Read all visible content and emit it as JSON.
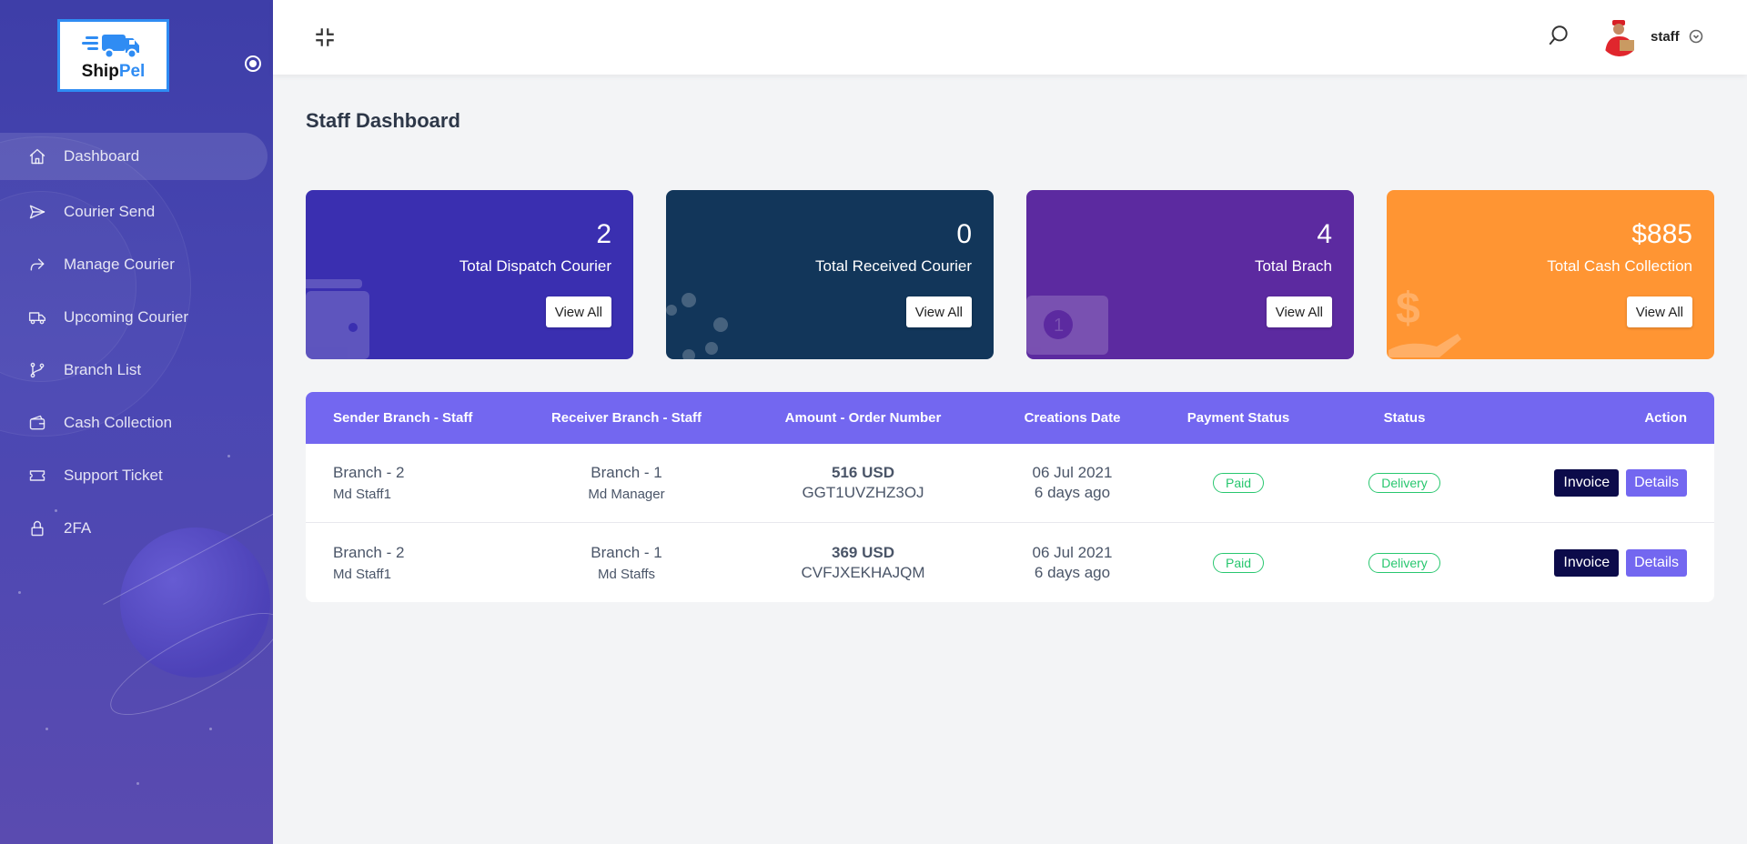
{
  "app": {
    "logo_part1": "Ship",
    "logo_part2": "Pel"
  },
  "sidebar": {
    "items": [
      {
        "label": "Dashboard",
        "icon": "home-icon",
        "active": true
      },
      {
        "label": "Courier Send",
        "icon": "send-icon"
      },
      {
        "label": "Manage Courier",
        "icon": "share-forward-icon"
      },
      {
        "label": "Upcoming Courier",
        "icon": "truck-icon"
      },
      {
        "label": "Branch List",
        "icon": "git-branch-icon"
      },
      {
        "label": "Cash Collection",
        "icon": "wallet-icon"
      },
      {
        "label": "Support Ticket",
        "icon": "ticket-icon"
      },
      {
        "label": "2FA",
        "icon": "lock-icon"
      }
    ]
  },
  "topbar": {
    "user_name": "staff"
  },
  "page": {
    "title": "Staff Dashboard"
  },
  "cards": [
    {
      "value": "2",
      "label": "Total Dispatch Courier",
      "button": "View All",
      "color": "#3a2fb0",
      "icon": "wallet-icon"
    },
    {
      "value": "0",
      "label": "Total Received Courier",
      "button": "View All",
      "color": "#12365a",
      "icon": "dots-spinner-icon"
    },
    {
      "value": "4",
      "label": "Total Brach",
      "button": "View All",
      "color": "#5c2aa0",
      "icon": "money-note-icon"
    },
    {
      "value": "$885",
      "label": "Total Cash Collection",
      "button": "View All",
      "color": "#ff9533",
      "icon": "dollar-hand-icon"
    }
  ],
  "table": {
    "headers": [
      "Sender Branch - Staff",
      "Receiver Branch - Staff",
      "Amount - Order Number",
      "Creations Date",
      "Payment Status",
      "Status",
      "Action"
    ],
    "rows": [
      {
        "sender_branch": "Branch - 2",
        "sender_staff": "Md Staff1",
        "receiver_branch": "Branch - 1",
        "receiver_staff": "Md Manager",
        "amount": "516 USD",
        "order": "GGT1UVZHZ3OJ",
        "date": "06 Jul 2021",
        "ago": "6 days ago",
        "payment": "Paid",
        "status": "Delivery",
        "invoice": "Invoice",
        "details": "Details"
      },
      {
        "sender_branch": "Branch - 2",
        "sender_staff": "Md Staff1",
        "receiver_branch": "Branch - 1",
        "receiver_staff": "Md Staffs",
        "amount": "369 USD",
        "order": "CVFJXEKHAJQM",
        "date": "06 Jul 2021",
        "ago": "6 days ago",
        "payment": "Paid",
        "status": "Delivery",
        "invoice": "Invoice",
        "details": "Details"
      }
    ]
  }
}
